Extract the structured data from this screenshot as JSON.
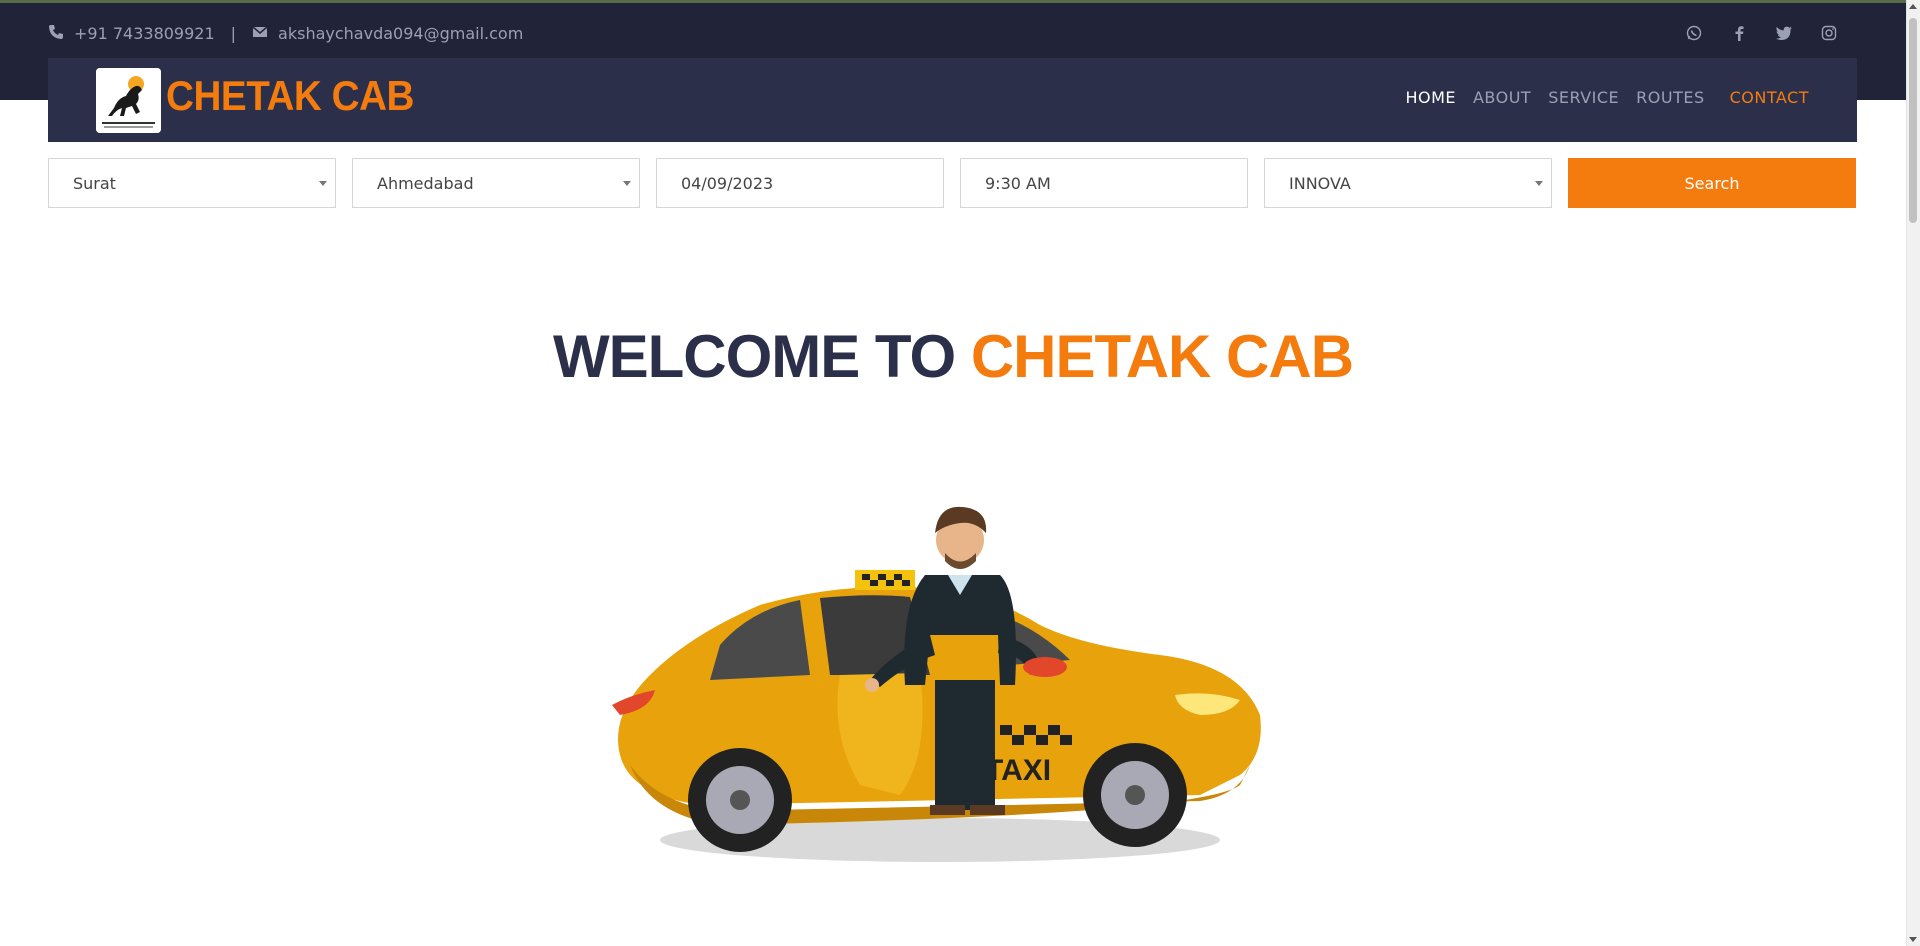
{
  "topbar": {
    "phone": "+91 7433809921",
    "email": "akshaychavda094@gmail.com",
    "social_icons": [
      "whatsapp-icon",
      "facebook-icon",
      "twitter-icon",
      "instagram-icon"
    ]
  },
  "navbar": {
    "brand": "CHETAK CAB",
    "menu": [
      "HOME",
      "ABOUT",
      "SERVICE",
      "ROUTES",
      "CONTACT"
    ],
    "active": "HOME"
  },
  "search": {
    "from": "Surat",
    "to": "Ahmedabad",
    "date": "04/09/2023",
    "time": "9:30 AM",
    "car": "INNOVA",
    "button": "Search"
  },
  "hero": {
    "welcome_prefix": "WELCOME TO",
    "welcome_brand": "CHETAK CAB"
  },
  "colors": {
    "accent": "#f47c0f",
    "dark": "#2c2f4a",
    "topbar": "#212338"
  }
}
